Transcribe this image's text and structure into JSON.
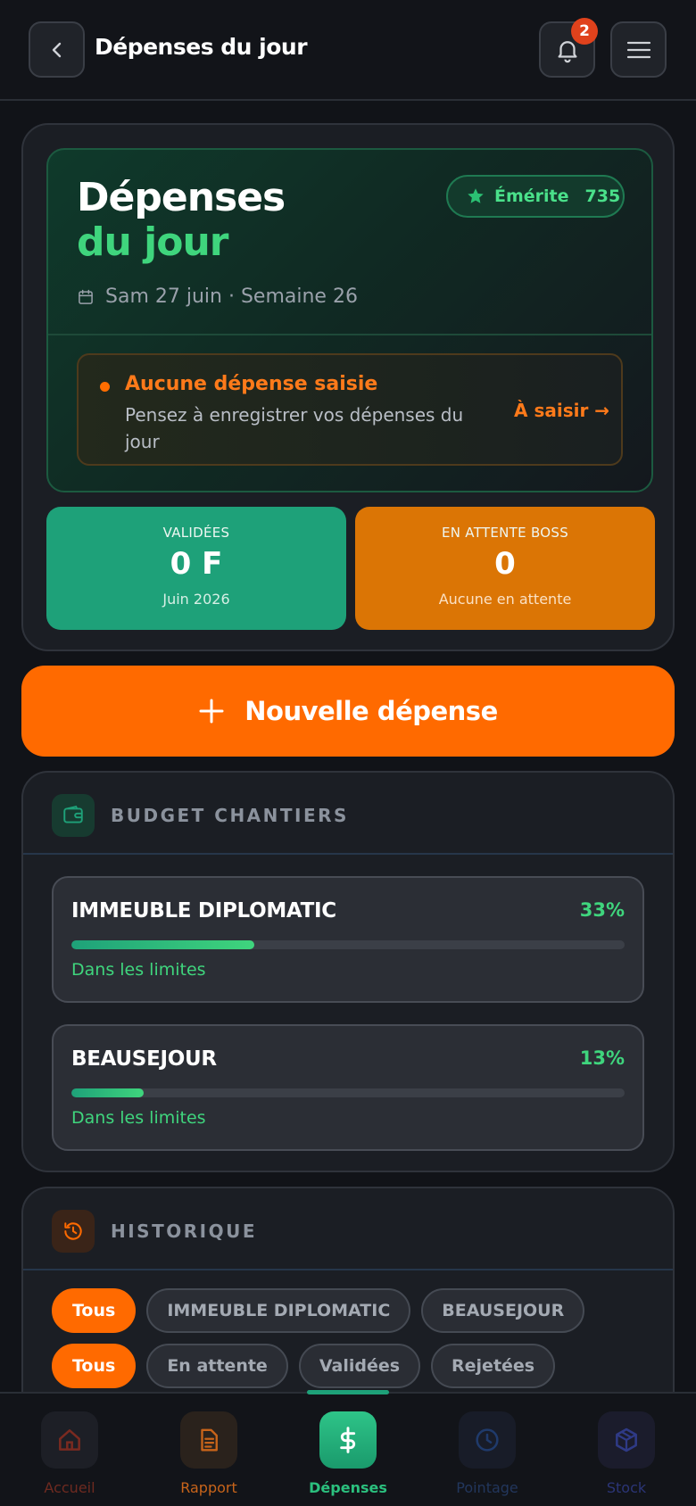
{
  "header": {
    "title": "Dépenses du jour",
    "notification_count": "2"
  },
  "hero": {
    "title_line1": "Dépenses",
    "title_line2": "du jour",
    "merit_label": "Émérite",
    "merit_score": "735",
    "date": "Sam 27 juin · Semaine 26"
  },
  "alert": {
    "title": "Aucune dépense saisie",
    "text": "Pensez à enregistrer vos dépenses du jour",
    "action": "À saisir →"
  },
  "stats": [
    {
      "label": "VALIDÉES",
      "value": "0 F",
      "sub": "Juin 2026",
      "color": "#1ea179"
    },
    {
      "label": "EN ATTENTE BOSS",
      "value": "0",
      "sub": "Aucune en attente",
      "color": "#db7505"
    }
  ],
  "new_expense": {
    "label": "Nouvelle dépense"
  },
  "budget": {
    "title": "BUDGET CHANTIERS",
    "items": [
      {
        "name": "IMMEUBLE DIPLOMATIC",
        "percent_label": "33%",
        "percent": 33,
        "status": "Dans les limites"
      },
      {
        "name": "BEAUSEJOUR",
        "percent_label": "13%",
        "percent": 13,
        "status": "Dans les limites"
      }
    ]
  },
  "history": {
    "title": "HISTORIQUE",
    "site_filters": [
      "Tous",
      "IMMEUBLE DIPLOMATIC",
      "BEAUSEJOUR"
    ],
    "status_filters": [
      "Tous",
      "En attente",
      "Validées",
      "Rejetées"
    ]
  },
  "nav": {
    "items": [
      {
        "label": "Accueil",
        "icon": "home-icon",
        "color": "#8a2a1e"
      },
      {
        "label": "Rapport",
        "icon": "document-icon",
        "color": "#c8641a"
      },
      {
        "label": "Dépenses",
        "icon": "dollar-icon",
        "color": "#1ea179"
      },
      {
        "label": "Pointage",
        "icon": "clock-icon",
        "color": "#1f3a6b"
      },
      {
        "label": "Stock",
        "icon": "box-icon",
        "color": "#2a3272"
      }
    ],
    "active": "Dépenses"
  },
  "colors": {
    "accent_orange": "#ff6a00",
    "accent_green": "#3fd57d",
    "background": "#111318"
  }
}
